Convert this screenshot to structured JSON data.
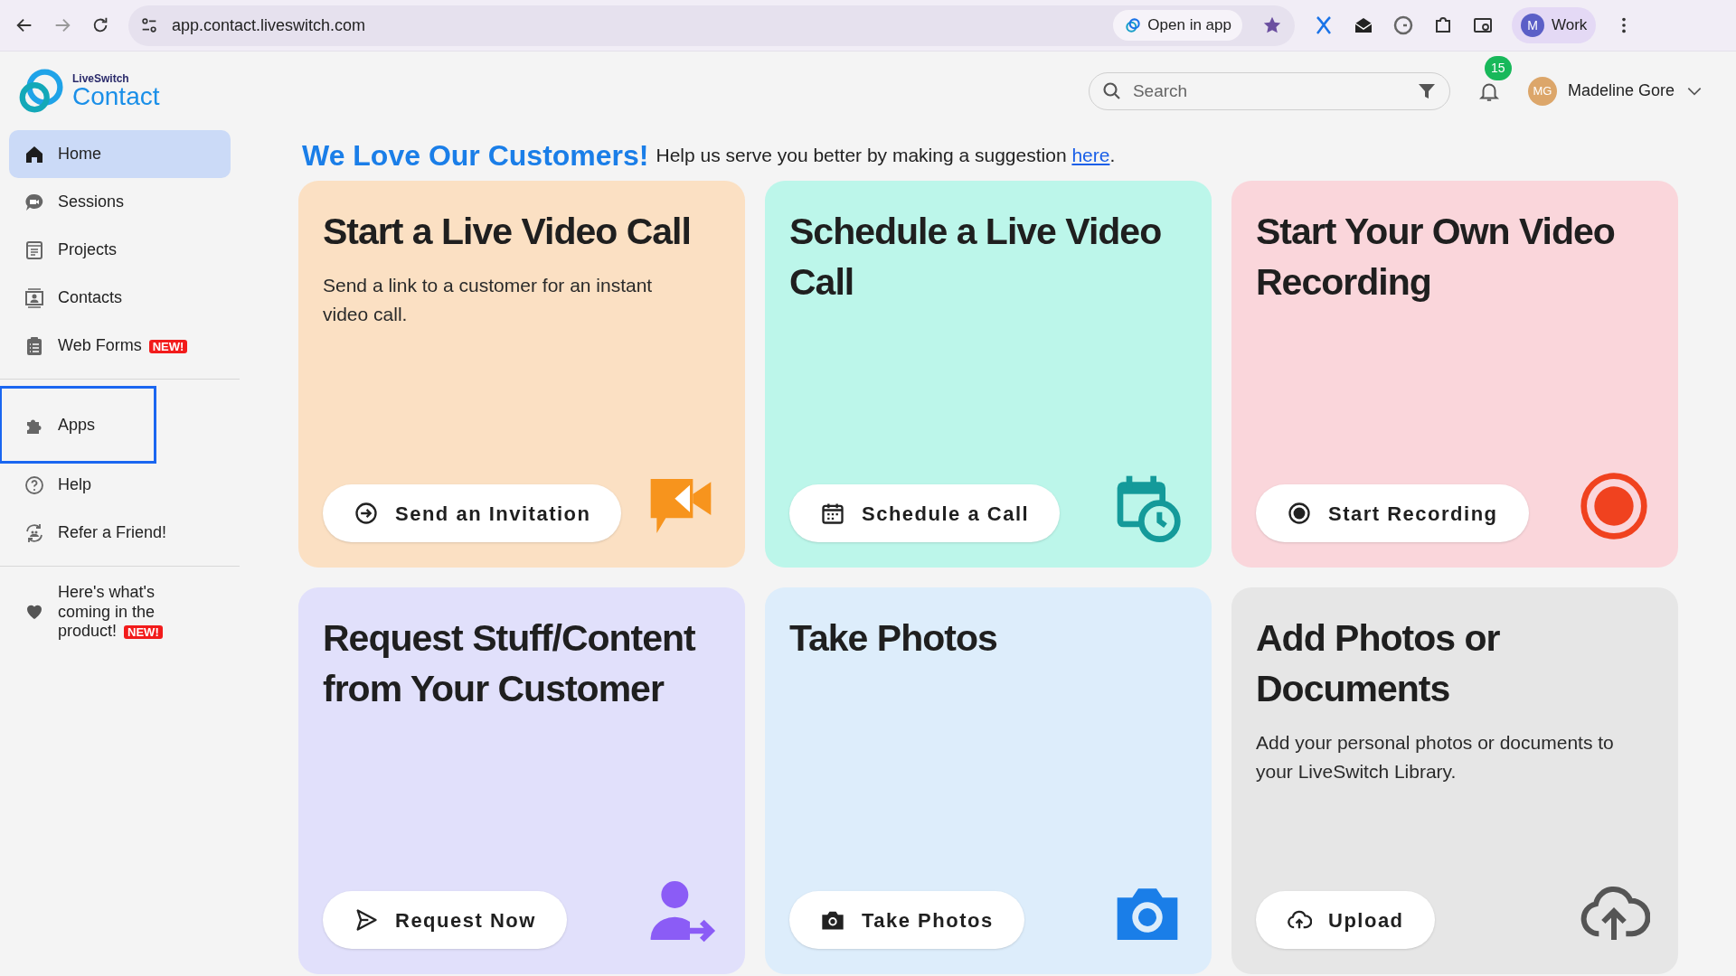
{
  "browser": {
    "url": "app.contact.liveswitch.com",
    "open_in_app": "Open in app",
    "profile_initial": "M",
    "profile_name": "Work"
  },
  "header": {
    "logo_small": "LiveSwitch",
    "logo_large": "Contact",
    "search": {
      "placeholder": "Search"
    },
    "notifications": "15",
    "user_initials": "MG",
    "user_name": "Madeline Gore"
  },
  "sidebar": {
    "items": [
      {
        "kind": "home",
        "label": "Home",
        "selected": true,
        "highlighted": false
      },
      {
        "kind": "sessions",
        "label": "Sessions",
        "selected": false,
        "highlighted": false
      },
      {
        "kind": "projects",
        "label": "Projects",
        "selected": false,
        "highlighted": false
      },
      {
        "kind": "contacts",
        "label": "Contacts",
        "selected": false,
        "highlighted": false
      },
      {
        "kind": "forms",
        "label": "Web Forms",
        "badge": "NEW!",
        "selected": false,
        "highlighted": false
      },
      {
        "kind": "apps",
        "label": "Apps",
        "selected": false,
        "highlighted": true
      },
      {
        "kind": "help",
        "label": "Help",
        "selected": false,
        "highlighted": false
      },
      {
        "kind": "refer",
        "label": "Refer a Friend!",
        "selected": false,
        "highlighted": false
      },
      {
        "kind": "coming",
        "label": "Here's what's coming in the product!",
        "badge": "NEW!",
        "selected": false,
        "highlighted": false
      }
    ]
  },
  "banner": {
    "heading": "We Love Our Customers!",
    "text": "Help us serve you better by making a suggestion ",
    "link": "here",
    "end": "."
  },
  "cards": [
    {
      "kind": "video",
      "title": "Start a Live Video Call",
      "description": "Send a link to a customer for an instant video call.",
      "button": "Send an Invitation",
      "color": "#fbe0c3"
    },
    {
      "kind": "schedule",
      "title": "Schedule a Live Video Call",
      "button": "Schedule a Call",
      "color": "#bcf6ea"
    },
    {
      "kind": "record",
      "title": "Start Your Own Video Recording",
      "button": "Start Recording",
      "color": "#fad6db"
    },
    {
      "kind": "request",
      "title": "Request Stuff/Content from Your Customer",
      "button": "Request Now",
      "color": "#e1e0fb"
    },
    {
      "kind": "photo",
      "title": "Take Photos",
      "button": "Take Photos",
      "color": "#ddedfb"
    },
    {
      "kind": "upload",
      "title": "Add Photos or Documents",
      "description": "Add your personal photos or documents to your LiveSwitch Library.",
      "button": "Upload",
      "color": "#e6e6e6"
    }
  ]
}
